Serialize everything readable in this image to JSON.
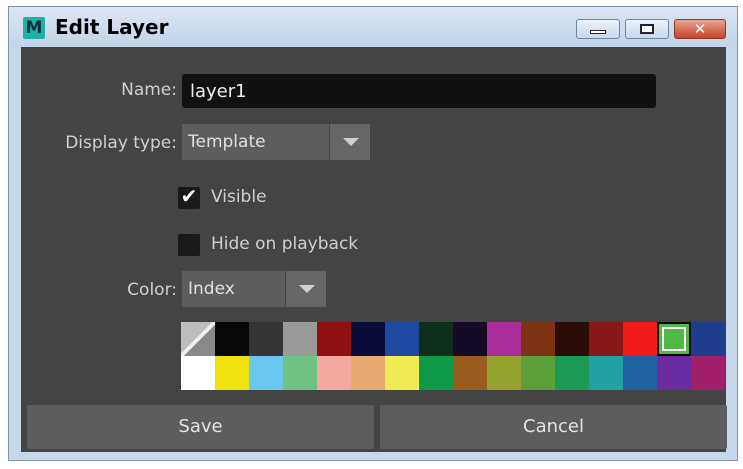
{
  "window": {
    "title": "Edit Layer",
    "app_icon_letter": "M"
  },
  "form": {
    "name_label": "Name:",
    "name_value": "layer1",
    "display_type_label": "Display type:",
    "display_type_value": "Template",
    "visible_label": "Visible",
    "visible_checked": true,
    "hide_on_playback_label": "Hide on playback",
    "hide_on_playback_checked": false,
    "color_label": "Color:",
    "color_mode_value": "Index"
  },
  "palette": {
    "selected_index": 14,
    "colors": [
      "none",
      "#080808",
      "#353535",
      "#9a9a9a",
      "#8e1212",
      "#0b0c3a",
      "#1d4aa0",
      "#102f1a",
      "#160b26",
      "#ab2f9a",
      "#7d3213",
      "#2a0d09",
      "#8a1717",
      "#f21a1a",
      "#4fb944",
      "#1e3d8c",
      "#ffffff",
      "#f0e20c",
      "#6bc6f0",
      "#6fc282",
      "#f3a9a2",
      "#e8aa72",
      "#f2ec54",
      "#0f9a4a",
      "#9a5b1e",
      "#96a331",
      "#5d9f39",
      "#1a9a55",
      "#239fa6",
      "#1f63a0",
      "#6a2aa0",
      "#a11f68"
    ]
  },
  "buttons": {
    "save_label": "Save",
    "cancel_label": "Cancel"
  }
}
